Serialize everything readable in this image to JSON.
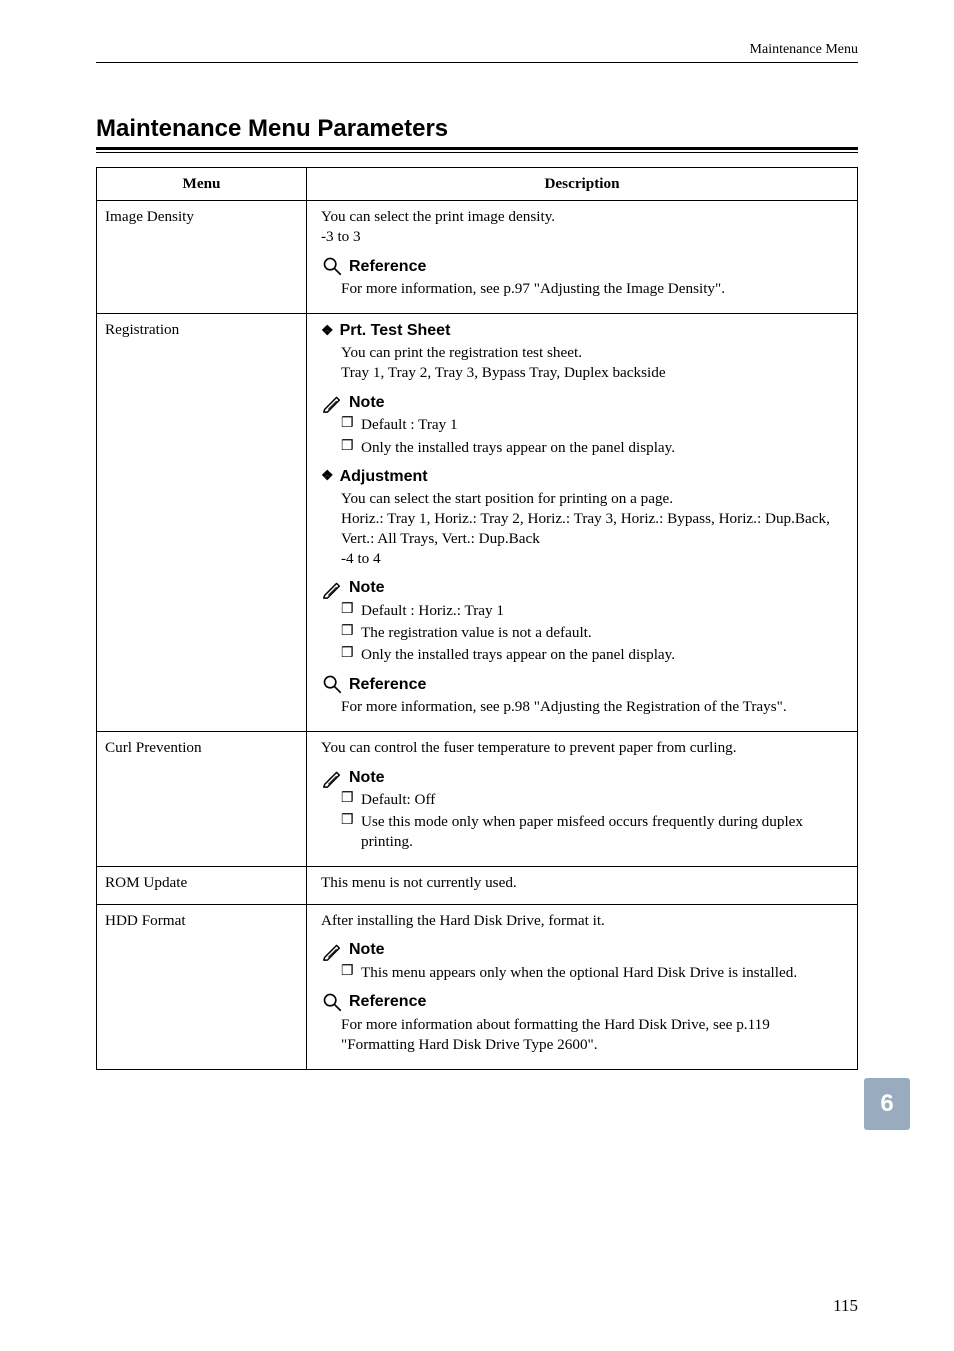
{
  "header": {
    "right_text": "Maintenance Menu"
  },
  "section_title": "Maintenance Menu Parameters",
  "table": {
    "headers": {
      "menu": "Menu",
      "description": "Description"
    },
    "rows": [
      {
        "menu": "Image Density",
        "desc": {
          "intro": "You can select the print image density.",
          "range": "-3 to 3",
          "ref_label": "Reference",
          "ref_body": "For more information, see p.97 \"Adjusting the Image Density\"."
        }
      },
      {
        "menu": "Registration",
        "desc": {
          "sub1_label": "Prt. Test Sheet",
          "sub1_body_l1": "You can print the registration test sheet.",
          "sub1_body_l2": "Tray 1, Tray 2, Tray 3, Bypass Tray, Duplex backside",
          "note1_label": "Note",
          "note1_bullets": [
            "Default : Tray 1",
            "Only the installed trays appear on the panel display."
          ],
          "sub2_label": "Adjustment",
          "sub2_body_l1": "You can select the start position for printing on a page.",
          "sub2_body_l2": "Horiz.: Tray 1, Horiz.: Tray 2, Horiz.: Tray 3, Horiz.: Bypass, Horiz.: Dup.Back, Vert.: All Trays, Vert.: Dup.Back",
          "sub2_body_l3": "-4 to 4",
          "note2_label": "Note",
          "note2_bullets": [
            "Default : Horiz.: Tray 1",
            "The registration value is not a default.",
            "Only the installed trays appear on the panel display."
          ],
          "ref_label": "Reference",
          "ref_body": "For more information, see p.98 \"Adjusting the Registration of the Trays\"."
        }
      },
      {
        "menu": "Curl Prevention",
        "desc": {
          "intro": "You can control the fuser temperature to prevent paper from curling.",
          "note_label": "Note",
          "note_bullets": [
            "Default: Off",
            "Use this mode only when paper misfeed occurs frequently during duplex printing."
          ]
        }
      },
      {
        "menu": "ROM Update",
        "desc": {
          "intro": "This menu is not currently used."
        }
      },
      {
        "menu": "HDD Format",
        "desc": {
          "intro": "After installing the Hard Disk Drive, format it.",
          "note_label": "Note",
          "note_bullets": [
            "This menu appears only when the optional Hard Disk Drive is installed."
          ],
          "ref_label": "Reference",
          "ref_body": "For more information about formatting the Hard Disk Drive, see p.119 \"Formatting Hard Disk Drive Type 2600\"."
        }
      }
    ]
  },
  "side_tab": "6",
  "page_number": "115"
}
